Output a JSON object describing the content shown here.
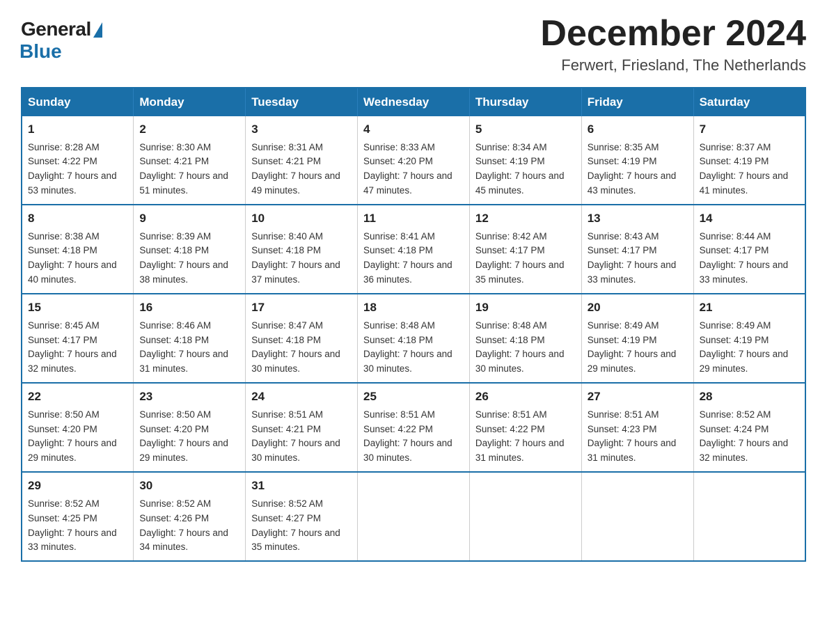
{
  "logo": {
    "general": "General",
    "blue": "Blue"
  },
  "title": "December 2024",
  "location": "Ferwert, Friesland, The Netherlands",
  "days_of_week": [
    "Sunday",
    "Monday",
    "Tuesday",
    "Wednesday",
    "Thursday",
    "Friday",
    "Saturday"
  ],
  "weeks": [
    [
      {
        "day": "1",
        "sunrise": "Sunrise: 8:28 AM",
        "sunset": "Sunset: 4:22 PM",
        "daylight": "Daylight: 7 hours and 53 minutes."
      },
      {
        "day": "2",
        "sunrise": "Sunrise: 8:30 AM",
        "sunset": "Sunset: 4:21 PM",
        "daylight": "Daylight: 7 hours and 51 minutes."
      },
      {
        "day": "3",
        "sunrise": "Sunrise: 8:31 AM",
        "sunset": "Sunset: 4:21 PM",
        "daylight": "Daylight: 7 hours and 49 minutes."
      },
      {
        "day": "4",
        "sunrise": "Sunrise: 8:33 AM",
        "sunset": "Sunset: 4:20 PM",
        "daylight": "Daylight: 7 hours and 47 minutes."
      },
      {
        "day": "5",
        "sunrise": "Sunrise: 8:34 AM",
        "sunset": "Sunset: 4:19 PM",
        "daylight": "Daylight: 7 hours and 45 minutes."
      },
      {
        "day": "6",
        "sunrise": "Sunrise: 8:35 AM",
        "sunset": "Sunset: 4:19 PM",
        "daylight": "Daylight: 7 hours and 43 minutes."
      },
      {
        "day": "7",
        "sunrise": "Sunrise: 8:37 AM",
        "sunset": "Sunset: 4:19 PM",
        "daylight": "Daylight: 7 hours and 41 minutes."
      }
    ],
    [
      {
        "day": "8",
        "sunrise": "Sunrise: 8:38 AM",
        "sunset": "Sunset: 4:18 PM",
        "daylight": "Daylight: 7 hours and 40 minutes."
      },
      {
        "day": "9",
        "sunrise": "Sunrise: 8:39 AM",
        "sunset": "Sunset: 4:18 PM",
        "daylight": "Daylight: 7 hours and 38 minutes."
      },
      {
        "day": "10",
        "sunrise": "Sunrise: 8:40 AM",
        "sunset": "Sunset: 4:18 PM",
        "daylight": "Daylight: 7 hours and 37 minutes."
      },
      {
        "day": "11",
        "sunrise": "Sunrise: 8:41 AM",
        "sunset": "Sunset: 4:18 PM",
        "daylight": "Daylight: 7 hours and 36 minutes."
      },
      {
        "day": "12",
        "sunrise": "Sunrise: 8:42 AM",
        "sunset": "Sunset: 4:17 PM",
        "daylight": "Daylight: 7 hours and 35 minutes."
      },
      {
        "day": "13",
        "sunrise": "Sunrise: 8:43 AM",
        "sunset": "Sunset: 4:17 PM",
        "daylight": "Daylight: 7 hours and 33 minutes."
      },
      {
        "day": "14",
        "sunrise": "Sunrise: 8:44 AM",
        "sunset": "Sunset: 4:17 PM",
        "daylight": "Daylight: 7 hours and 33 minutes."
      }
    ],
    [
      {
        "day": "15",
        "sunrise": "Sunrise: 8:45 AM",
        "sunset": "Sunset: 4:17 PM",
        "daylight": "Daylight: 7 hours and 32 minutes."
      },
      {
        "day": "16",
        "sunrise": "Sunrise: 8:46 AM",
        "sunset": "Sunset: 4:18 PM",
        "daylight": "Daylight: 7 hours and 31 minutes."
      },
      {
        "day": "17",
        "sunrise": "Sunrise: 8:47 AM",
        "sunset": "Sunset: 4:18 PM",
        "daylight": "Daylight: 7 hours and 30 minutes."
      },
      {
        "day": "18",
        "sunrise": "Sunrise: 8:48 AM",
        "sunset": "Sunset: 4:18 PM",
        "daylight": "Daylight: 7 hours and 30 minutes."
      },
      {
        "day": "19",
        "sunrise": "Sunrise: 8:48 AM",
        "sunset": "Sunset: 4:18 PM",
        "daylight": "Daylight: 7 hours and 30 minutes."
      },
      {
        "day": "20",
        "sunrise": "Sunrise: 8:49 AM",
        "sunset": "Sunset: 4:19 PM",
        "daylight": "Daylight: 7 hours and 29 minutes."
      },
      {
        "day": "21",
        "sunrise": "Sunrise: 8:49 AM",
        "sunset": "Sunset: 4:19 PM",
        "daylight": "Daylight: 7 hours and 29 minutes."
      }
    ],
    [
      {
        "day": "22",
        "sunrise": "Sunrise: 8:50 AM",
        "sunset": "Sunset: 4:20 PM",
        "daylight": "Daylight: 7 hours and 29 minutes."
      },
      {
        "day": "23",
        "sunrise": "Sunrise: 8:50 AM",
        "sunset": "Sunset: 4:20 PM",
        "daylight": "Daylight: 7 hours and 29 minutes."
      },
      {
        "day": "24",
        "sunrise": "Sunrise: 8:51 AM",
        "sunset": "Sunset: 4:21 PM",
        "daylight": "Daylight: 7 hours and 30 minutes."
      },
      {
        "day": "25",
        "sunrise": "Sunrise: 8:51 AM",
        "sunset": "Sunset: 4:22 PM",
        "daylight": "Daylight: 7 hours and 30 minutes."
      },
      {
        "day": "26",
        "sunrise": "Sunrise: 8:51 AM",
        "sunset": "Sunset: 4:22 PM",
        "daylight": "Daylight: 7 hours and 31 minutes."
      },
      {
        "day": "27",
        "sunrise": "Sunrise: 8:51 AM",
        "sunset": "Sunset: 4:23 PM",
        "daylight": "Daylight: 7 hours and 31 minutes."
      },
      {
        "day": "28",
        "sunrise": "Sunrise: 8:52 AM",
        "sunset": "Sunset: 4:24 PM",
        "daylight": "Daylight: 7 hours and 32 minutes."
      }
    ],
    [
      {
        "day": "29",
        "sunrise": "Sunrise: 8:52 AM",
        "sunset": "Sunset: 4:25 PM",
        "daylight": "Daylight: 7 hours and 33 minutes."
      },
      {
        "day": "30",
        "sunrise": "Sunrise: 8:52 AM",
        "sunset": "Sunset: 4:26 PM",
        "daylight": "Daylight: 7 hours and 34 minutes."
      },
      {
        "day": "31",
        "sunrise": "Sunrise: 8:52 AM",
        "sunset": "Sunset: 4:27 PM",
        "daylight": "Daylight: 7 hours and 35 minutes."
      },
      null,
      null,
      null,
      null
    ]
  ]
}
